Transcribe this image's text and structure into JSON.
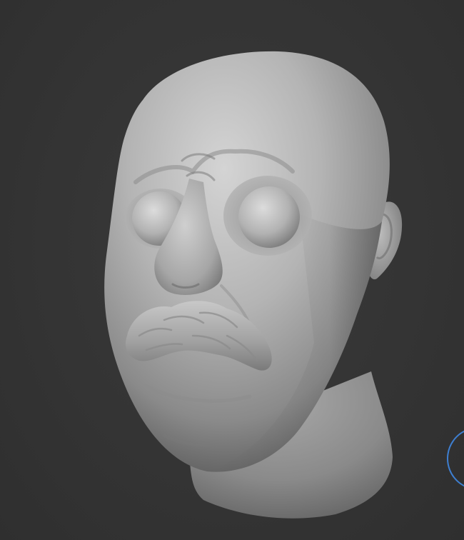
{
  "colors": {
    "viewport_background": "#333333",
    "clay_base": "#9c9c9c",
    "clay_highlight": "#d2d2d2",
    "clay_shadow": "#5a5a5a",
    "navigation_gizmo_ring": "#3e7fd1"
  },
  "icons": {
    "navigation_gizmo": "view-rotation-gizmo-icon"
  }
}
